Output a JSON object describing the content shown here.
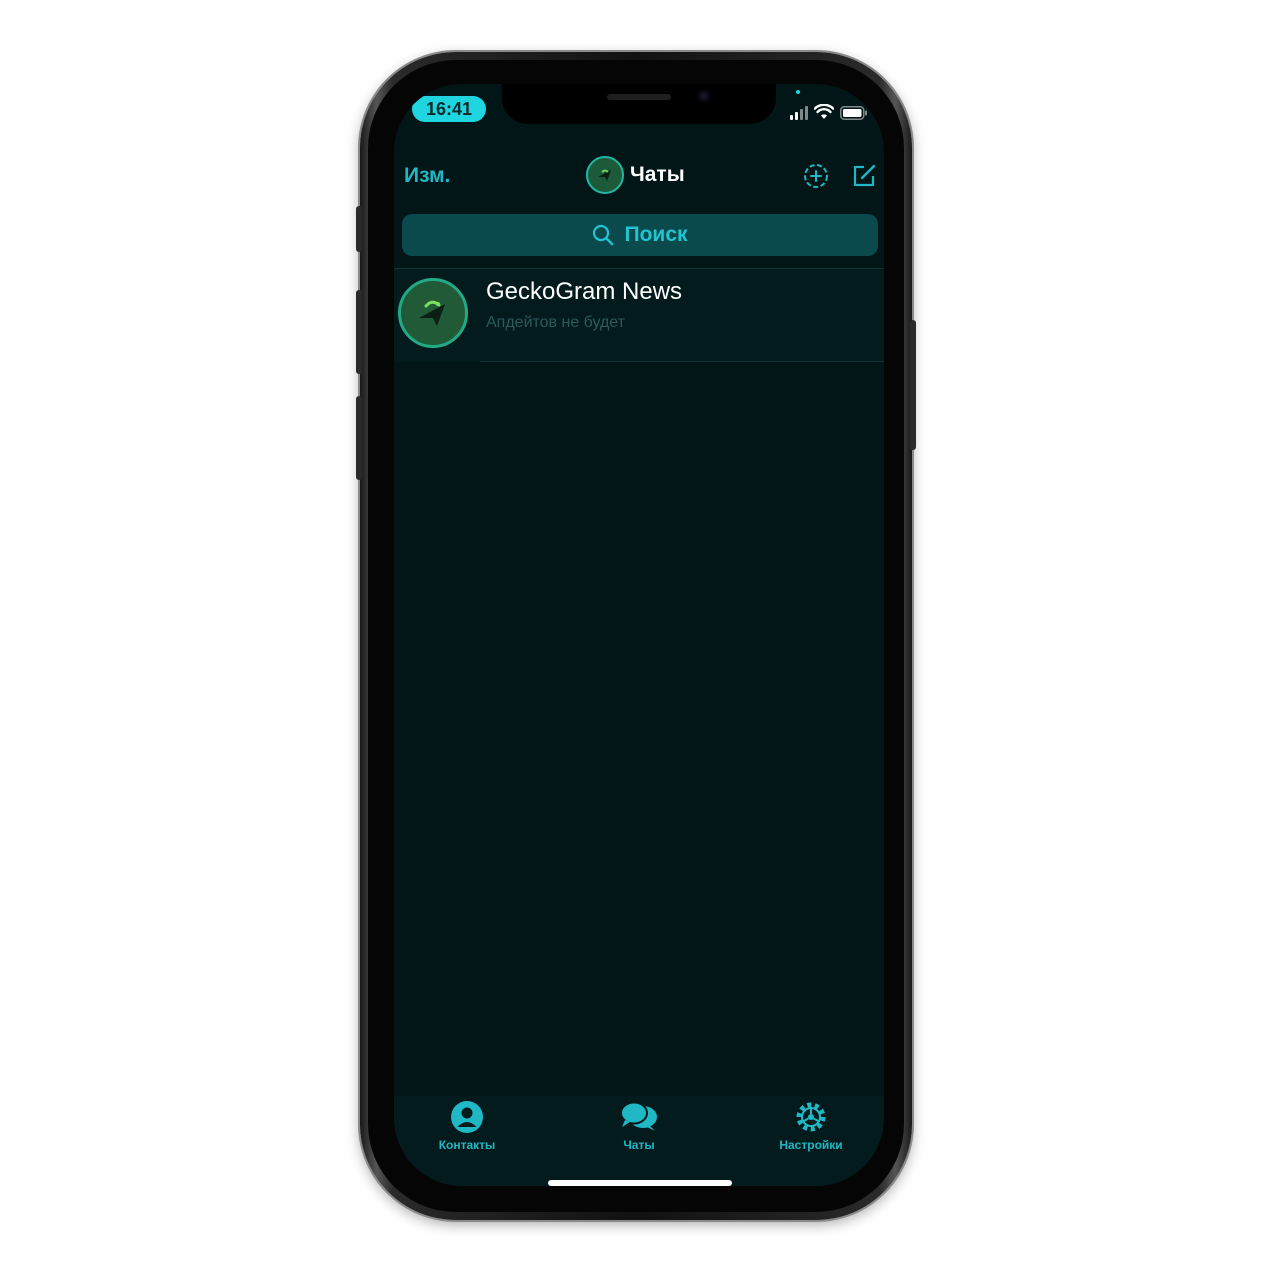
{
  "status_bar": {
    "time": "16:41"
  },
  "nav": {
    "edit_label": "Изм.",
    "title": "Чаты"
  },
  "search": {
    "label": "Поиск"
  },
  "chats": [
    {
      "name": "GeckoGram News",
      "message": "Апдейтов не будет"
    }
  ],
  "tabbar": {
    "contacts_label": "Контакты",
    "chats_label": "Чаты",
    "settings_label": "Настройки"
  },
  "colors": {
    "accent": "#1fb8c4",
    "background": "#021517",
    "time_pill": "#1fd6e0"
  },
  "icons": [
    "search-icon",
    "new-story-icon",
    "compose-icon",
    "person-icon",
    "chat-bubbles-icon",
    "gear-icon",
    "wifi-icon",
    "battery-icon",
    "signal-icon"
  ]
}
